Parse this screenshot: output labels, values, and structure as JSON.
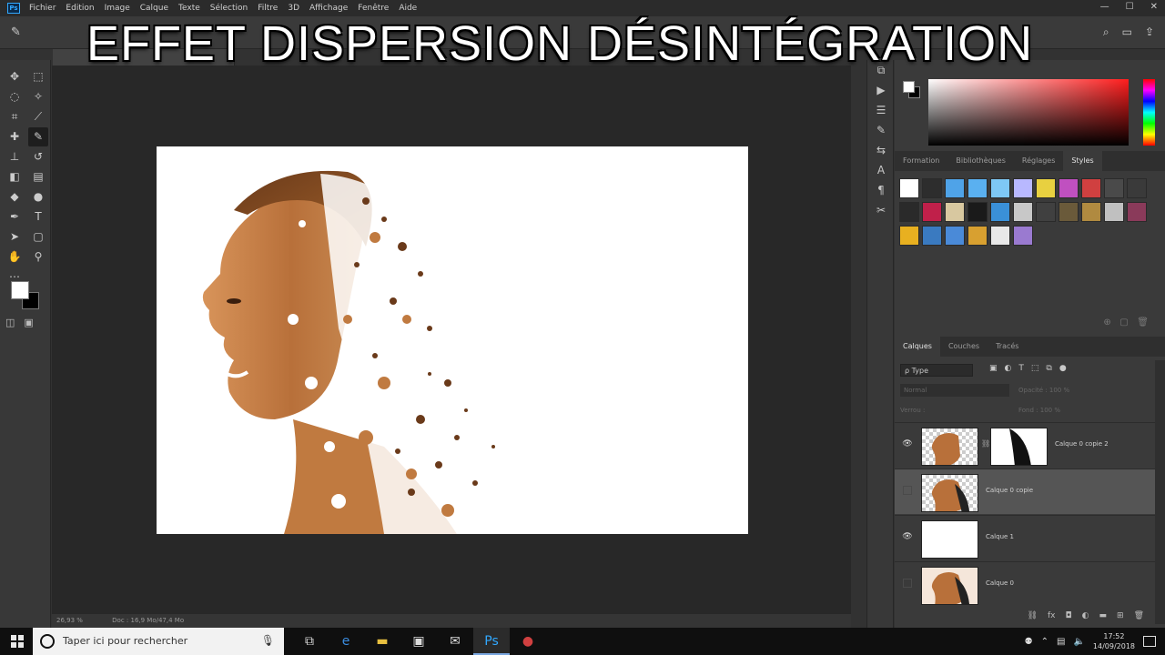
{
  "overlay": {
    "title": "EFFET DISPERSION DÉSINTÉGRATION"
  },
  "menu": {
    "items": [
      "Fichier",
      "Edition",
      "Image",
      "Calque",
      "Texte",
      "Sélection",
      "Filtre",
      "3D",
      "Affichage",
      "Fenêtre",
      "Aide"
    ]
  },
  "status": {
    "zoom": "26,93 %",
    "doc": "Doc : 16,9 Mo/47,4 Mo"
  },
  "right_panel": {
    "style_tabs": [
      "Formation",
      "Bibliothèques",
      "Réglages",
      "Styles"
    ],
    "active_style_tab": "Styles",
    "layer_tabs": [
      "Calques",
      "Couches",
      "Tracés"
    ],
    "active_layer_tab": "Calques",
    "filter_label": "ρ Type",
    "blend_mode": "Normal",
    "opacity_label": "Opacité : 100 %",
    "lock_label": "Verrou :",
    "fill_label": "Fond : 100 %"
  },
  "layers": [
    {
      "name": "Calque 0 copie 2",
      "visible": true,
      "selected": false
    },
    {
      "name": "Calque 0 copie",
      "visible": false,
      "selected": true
    },
    {
      "name": "Calque 1",
      "visible": true,
      "selected": false
    },
    {
      "name": "Calque 0",
      "visible": false,
      "selected": false
    }
  ],
  "styles_swatches": [
    "#ffffff",
    "#2d2d2d",
    "#4fa3e8",
    "#5ab0f0",
    "#7ec8f5",
    "#b8b8ff",
    "#e8d040",
    "#c050c0",
    "#d04040",
    "#4a4a4a",
    "#3a3a3a",
    "#2a2a2a",
    "#c0204a",
    "#d8c8a0",
    "#1a1a1a",
    "#3a90d8",
    "#c8c8c8",
    "#404040",
    "#6a5a3a",
    "#b08a40",
    "#c0c0c0",
    "#8a3a5a",
    "#e8b020",
    "#3a7ac0",
    "#4a8ad8",
    "#d8a030",
    "#e8e8e8",
    "#9a7ad0"
  ],
  "taskbar": {
    "search_placeholder": "Taper ici pour rechercher",
    "time": "17:52",
    "date": "14/09/2018"
  },
  "colors": {
    "fg": "#ffffff",
    "bg": "#000000",
    "accent": "#31a8ff"
  }
}
